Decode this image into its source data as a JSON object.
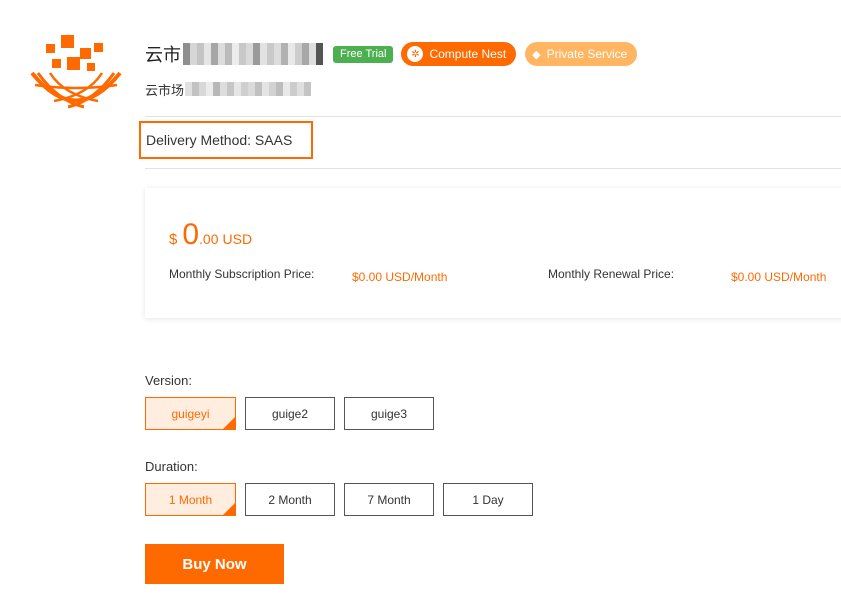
{
  "product": {
    "title_visible": "云市",
    "subtitle_visible": "云市场",
    "badges": {
      "free_trial": "Free Trial",
      "compute_nest": "Compute Nest",
      "private_service": "Private Service"
    },
    "icons": {
      "compute_nest": "gear-circle-icon",
      "private_service": "diamond-icon",
      "logo": "aliyun-marketplace-logo"
    }
  },
  "delivery": {
    "label": "Delivery Method: SAAS"
  },
  "pricing": {
    "currency_symbol": "$",
    "price_integer": "0",
    "price_decimal": ".00",
    "price_unit": "USD",
    "monthly_subscription_label": "Monthly Subscription Price:",
    "monthly_subscription_value": "$0.00 USD/Month",
    "monthly_renewal_label": "Monthly Renewal Price:",
    "monthly_renewal_value": "$0.00 USD/Month"
  },
  "version": {
    "label": "Version:",
    "options": [
      "guigeyi",
      "guige2",
      "guige3"
    ],
    "selected": "guigeyi"
  },
  "duration": {
    "label": "Duration:",
    "options": [
      "1 Month",
      "2 Month",
      "7 Month",
      "1 Day"
    ],
    "selected": "1 Month"
  },
  "actions": {
    "buy_now": "Buy Now"
  },
  "colors": {
    "accent": "#ff6a00",
    "free_trial_badge": "#4caf50",
    "private_service_badge": "#ffb562",
    "selected_option_bg": "#ffeee0"
  }
}
